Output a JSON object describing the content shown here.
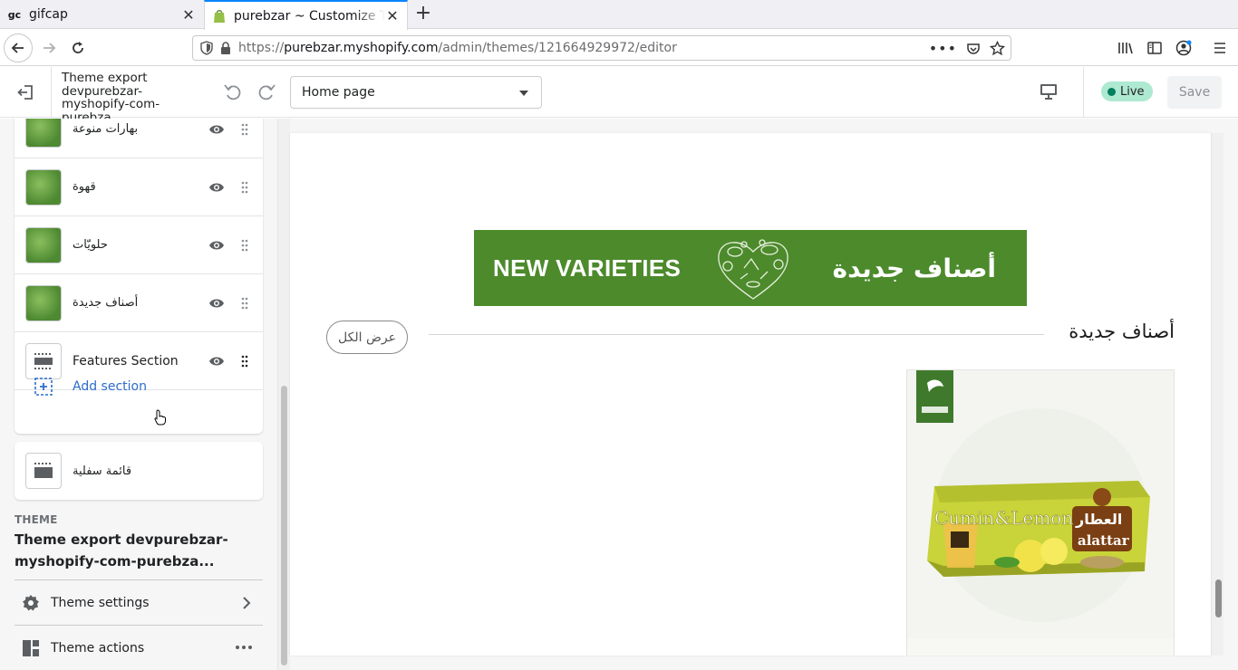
{
  "browser": {
    "tabs": [
      {
        "favicon": "gc",
        "title": "gifcap"
      },
      {
        "favicon": "shopify-bag-icon",
        "title": "purebzar ~ Customize Th"
      }
    ],
    "url": {
      "scheme": "https://",
      "host": "purebzar.myshopify.com",
      "path": "/admin/themes/121664929972/editor"
    }
  },
  "editor": {
    "theme_name": "Theme export devpurebzar-myshopify-com-purebza...",
    "page_select": "Home page",
    "status": "Live",
    "save_label": "Save"
  },
  "sidebar": {
    "sections": [
      {
        "label": "بهارات منوعة",
        "type": "image"
      },
      {
        "label": "قهوة",
        "type": "image"
      },
      {
        "label": "حلويّات",
        "type": "image"
      },
      {
        "label": "أصناف جديدة",
        "type": "image"
      },
      {
        "label": "Features Section",
        "type": "layout"
      }
    ],
    "add_section": "Add section",
    "footer": "قائمة سفلية",
    "theme_heading": "THEME",
    "theme_title": "Theme export devpurebzar-myshopify-com-purebza...",
    "theme_settings": "Theme settings",
    "theme_actions": "Theme actions"
  },
  "preview": {
    "banner_en": "NEW VARIETIES",
    "banner_ar": "أصناف جديدة",
    "collection_title": "أصناف جديدة",
    "view_all": "عرض الكل",
    "product_brand": "العطار",
    "product_brand_latin": "alattar",
    "product_name": "Cumin&Lemon"
  },
  "colors": {
    "accent": "#2c6ecb",
    "live_badge": "#aee9d1",
    "banner_green": "#4c8a2c"
  }
}
